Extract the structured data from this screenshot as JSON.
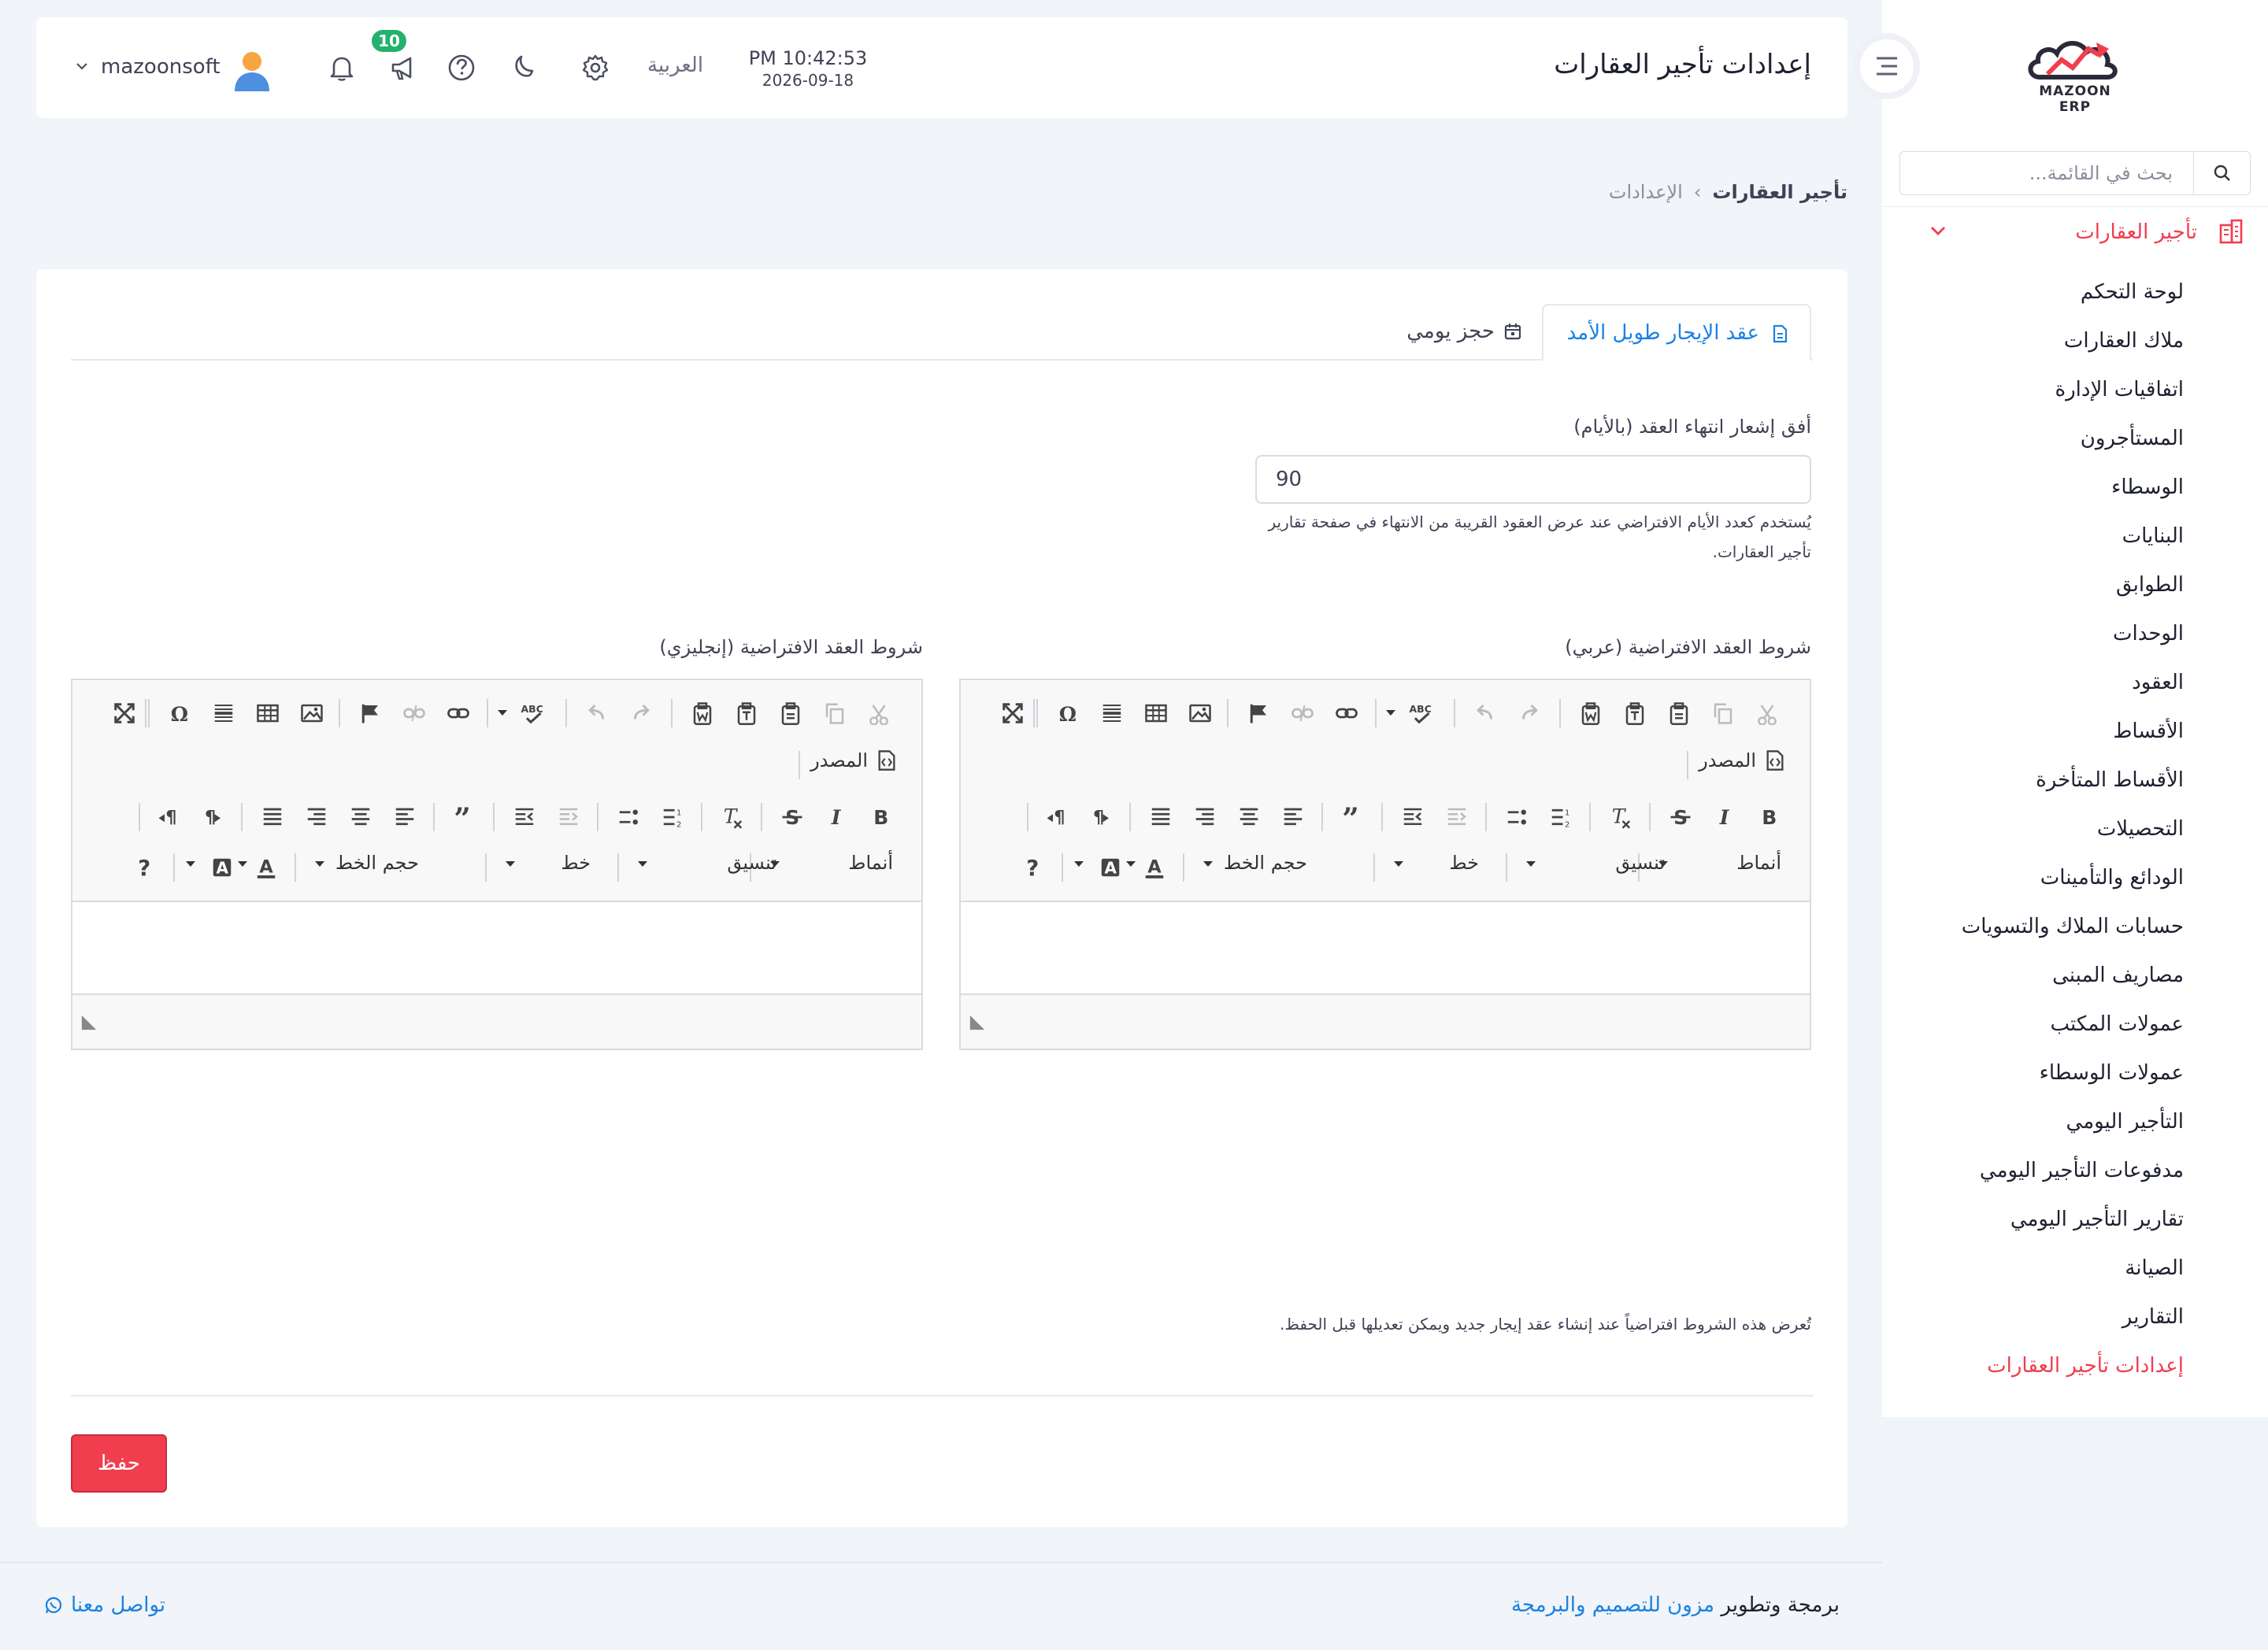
{
  "sidebar": {
    "logo_text": "MAZOON ERP",
    "search_placeholder": "بحث في القائمة...",
    "section_label": "تأجير العقارات",
    "items": [
      {
        "label": "لوحة التحكم"
      },
      {
        "label": "ملاك العقارات"
      },
      {
        "label": "اتفاقيات الإدارة"
      },
      {
        "label": "المستأجرون"
      },
      {
        "label": "الوسطاء"
      },
      {
        "label": "البنايات"
      },
      {
        "label": "الطوابق"
      },
      {
        "label": "الوحدات"
      },
      {
        "label": "العقود"
      },
      {
        "label": "الأقساط"
      },
      {
        "label": "الأقساط المتأخرة"
      },
      {
        "label": "التحصيلات"
      },
      {
        "label": "الودائع والتأمينات"
      },
      {
        "label": "حسابات الملاك والتسويات"
      },
      {
        "label": "مصاريف المبنى"
      },
      {
        "label": "عمولات المكتب"
      },
      {
        "label": "عمولات الوسطاء"
      },
      {
        "label": "التأجير اليومي"
      },
      {
        "label": "مدفوعات التأجير اليومي"
      },
      {
        "label": "تقارير التأجير اليومي"
      },
      {
        "label": "الصيانة"
      },
      {
        "label": "التقارير"
      },
      {
        "label": "إعدادات تأجير العقارات",
        "active": true
      }
    ]
  },
  "header": {
    "title": "إعدادات تأجير العقارات",
    "time": "PM 10:42:53",
    "date": "2026-09-18",
    "language": "العربية",
    "notification_count": "10",
    "username": "mazoonsoft",
    "icons": [
      "gear-icon",
      "moon-icon",
      "help-circle-icon",
      "megaphone-icon",
      "bell-icon",
      "avatar"
    ]
  },
  "breadcrumb": {
    "current": "تأجير العقارات",
    "separator": "›",
    "parent": "الإعدادات"
  },
  "tabs": [
    {
      "label": "عقد الإيجار طويل الأمد",
      "active": true
    },
    {
      "label": "حجز يومي",
      "active": false
    }
  ],
  "form": {
    "horizon_label": "أفق إشعار انتهاء العقد (بالأيام)",
    "horizon_value": "90",
    "horizon_help": "يُستخدم كعدد الأيام الافتراضي عند عرض العقود القريبة من الانتهاء في صفحة تقارير تأجير العقارات.",
    "terms_ar_label": "شروط العقد الافتراضية (عربي)",
    "terms_en_label": "شروط العقد الافتراضية (إنجليزي)",
    "editor_note": "تُعرض هذه الشروط افتراضياً عند إنشاء عقد إيجار جديد ويمكن تعديلها قبل الحفظ.",
    "save_label": "حفظ"
  },
  "editor_toolbar": {
    "source_label": "المصدر",
    "styles_label": "أنماط",
    "format_label": "تنسيق",
    "font_label": "خط",
    "size_label": "حجم الخط"
  },
  "footer": {
    "prefix": "برمجة وتطوير ",
    "brand": "مزون للتصميم والبرمجة",
    "contact": "تواصل معنا"
  },
  "colors": {
    "accent": "#f03e4f",
    "link": "#1a82e2",
    "badge": "#23b26d",
    "page_bg": "#f1f4f8"
  }
}
